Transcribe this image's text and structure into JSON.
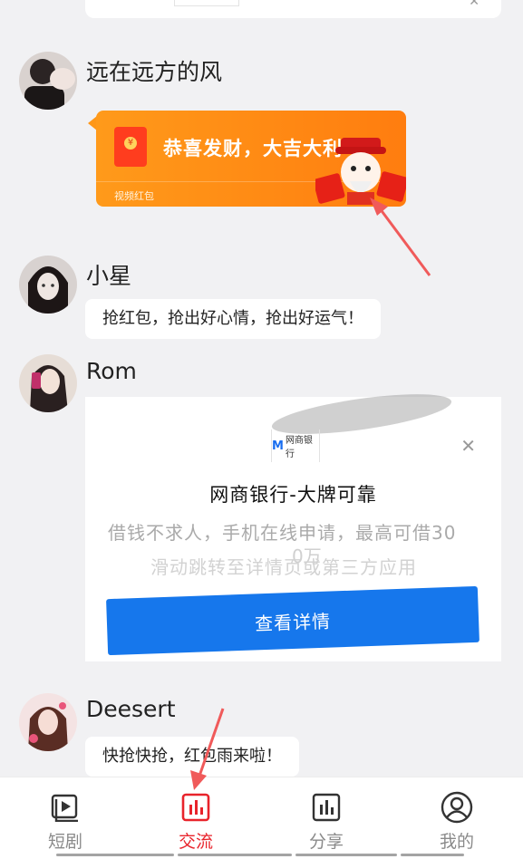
{
  "messages": [
    {
      "username": "远在远方的风"
    },
    {
      "username": "小星",
      "text": "抢红包，抢出好心情，抢出好运气！"
    },
    {
      "username": "Rom"
    },
    {
      "username": "Deesert",
      "text": "快抢快抢，红包雨来啦！"
    }
  ],
  "red_packet": {
    "title": "恭喜发财，大吉大利",
    "label": "视频红包",
    "icon": "red-envelope-icon",
    "color": "#ff8a14"
  },
  "ad": {
    "logo_text": "网商银行",
    "title": "网商银行-大牌可靠",
    "desc_line1": "借钱不求人，手机在线申请，最高可借30",
    "desc_line2a": "0万",
    "desc_line2": "滑动跳转至详情页或第三方应用",
    "button_label": "查看详情",
    "button_color": "#1677ec"
  },
  "tabbar": {
    "tabs": [
      {
        "label": "短剧",
        "icon": "play-video-icon",
        "active": false
      },
      {
        "label": "交流",
        "icon": "bar-chart-icon",
        "active": true
      },
      {
        "label": "分享",
        "icon": "bar-chart-icon",
        "active": false
      },
      {
        "label": "我的",
        "icon": "user-profile-icon",
        "active": false
      }
    ],
    "active_color": "#e8232b"
  }
}
